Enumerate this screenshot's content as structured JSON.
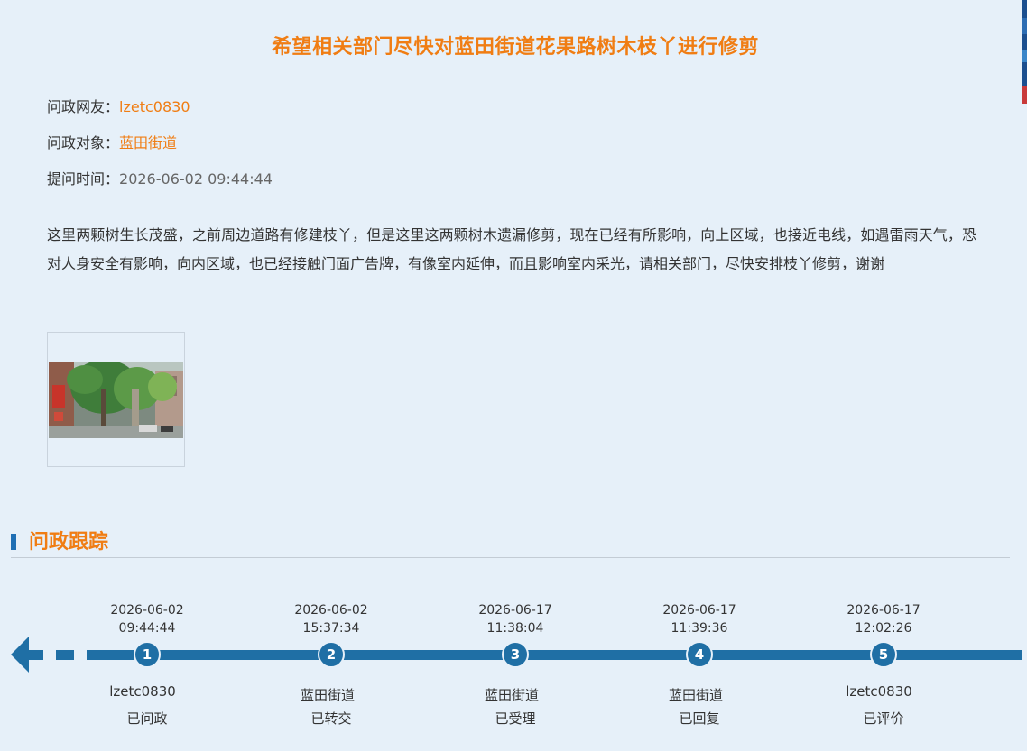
{
  "question": {
    "title": "希望相关部门尽快对蓝田街道花果路树木枝丫进行修剪",
    "asker_label": "问政网友：",
    "asker_value": "lzetc0830",
    "target_label": "问政对象：",
    "target_value": "蓝田街道",
    "time_label": "提问时间：",
    "time_value": "2026-06-02 09:44:44",
    "content": "这里两颗树生长茂盛，之前周边道路有修建枝丫，但是这里这两颗树木遗漏修剪，现在已经有所影响，向上区域，也接近电线，如遇雷雨天气，恐对人身安全有影响，向内区域，也已经接触门面广告牌，有像室内延伸，而且影响室内采光，请相关部门，尽快安排枝丫修剪，谢谢"
  },
  "tracking": {
    "section_title": "问政跟踪",
    "steps": [
      {
        "num": "1",
        "date": "2026-06-02",
        "time": "09:44:44",
        "actor": "lzetc0830",
        "status": "已问政"
      },
      {
        "num": "2",
        "date": "2026-06-02",
        "time": "15:37:34",
        "actor": "蓝田街道",
        "status": "已转交"
      },
      {
        "num": "3",
        "date": "2026-06-17",
        "time": "11:38:04",
        "actor": "蓝田街道",
        "status": "已受理"
      },
      {
        "num": "4",
        "date": "2026-06-17",
        "time": "11:39:36",
        "actor": "蓝田街道",
        "status": "已回复"
      },
      {
        "num": "5",
        "date": "2026-06-17",
        "time": "12:02:26",
        "actor": "lzetc0830",
        "status": "已评价"
      }
    ]
  },
  "colors": {
    "accent": "#f07d13",
    "primary": "#1f6fa5",
    "background": "#e6f0f9"
  }
}
